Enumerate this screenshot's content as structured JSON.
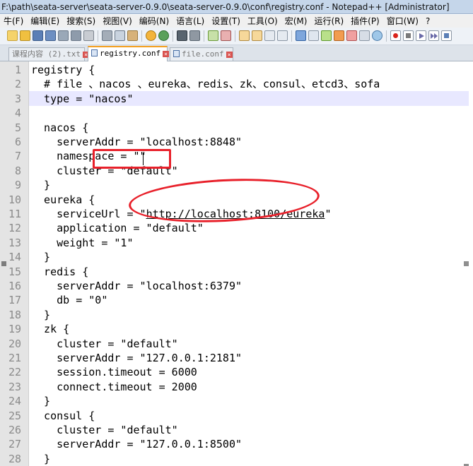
{
  "window": {
    "title": "F:\\path\\seata-server\\seata-server-0.9.0\\seata-server-0.9.0\\conf\\registry.conf - Notepad++ [Administrator]"
  },
  "menu": {
    "items": [
      "牛(F)",
      "编辑(E)",
      "搜索(S)",
      "视图(V)",
      "编码(N)",
      "语言(L)",
      "设置(T)",
      "工具(O)",
      "宏(M)",
      "运行(R)",
      "插件(P)",
      "窗口(W)",
      "?"
    ]
  },
  "tabs": [
    {
      "label": "课程内容 (2).txt",
      "active": false
    },
    {
      "label": "registry.conf",
      "active": true
    },
    {
      "label": "file.conf",
      "active": false
    }
  ],
  "editor": {
    "current_line": 3,
    "lines": [
      {
        "n": "1",
        "text": "registry {"
      },
      {
        "n": "2",
        "text": "  # file 、nacos 、eureka、redis、zk、consul、etcd3、sofa"
      },
      {
        "n": "3",
        "text": "  type = \"nacos\""
      },
      {
        "n": "4",
        "text": ""
      },
      {
        "n": "5",
        "text": "  nacos {"
      },
      {
        "n": "6",
        "text": "    serverAddr = \"localhost:8848\""
      },
      {
        "n": "7",
        "text": "    namespace = \"\""
      },
      {
        "n": "8",
        "text": "    cluster = \"default\""
      },
      {
        "n": "9",
        "text": "  }"
      },
      {
        "n": "10",
        "text": "  eureka {"
      },
      {
        "n": "11",
        "pre": "    serviceUrl = \"",
        "url": "http://localhost:8100/eureka",
        "post": "\""
      },
      {
        "n": "12",
        "text": "    application = \"default\""
      },
      {
        "n": "13",
        "text": "    weight = \"1\""
      },
      {
        "n": "14",
        "text": "  }"
      },
      {
        "n": "15",
        "text": "  redis {"
      },
      {
        "n": "16",
        "text": "    serverAddr = \"localhost:6379\""
      },
      {
        "n": "17",
        "text": "    db = \"0\""
      },
      {
        "n": "18",
        "text": "  }"
      },
      {
        "n": "19",
        "text": "  zk {"
      },
      {
        "n": "20",
        "text": "    cluster = \"default\""
      },
      {
        "n": "21",
        "text": "    serverAddr = \"127.0.0.1:2181\""
      },
      {
        "n": "22",
        "text": "    session.timeout = 6000"
      },
      {
        "n": "23",
        "text": "    connect.timeout = 2000"
      },
      {
        "n": "24",
        "text": "  }"
      },
      {
        "n": "25",
        "text": "  consul {"
      },
      {
        "n": "26",
        "text": "    cluster = \"default\""
      },
      {
        "n": "27",
        "text": "    serverAddr = \"127.0.0.1:8500\""
      },
      {
        "n": "28",
        "text": "  }"
      }
    ]
  },
  "colors": {
    "annotation": "#e8202a",
    "current_line": "#e8e8ff",
    "gutter": "#e4e4e4"
  }
}
